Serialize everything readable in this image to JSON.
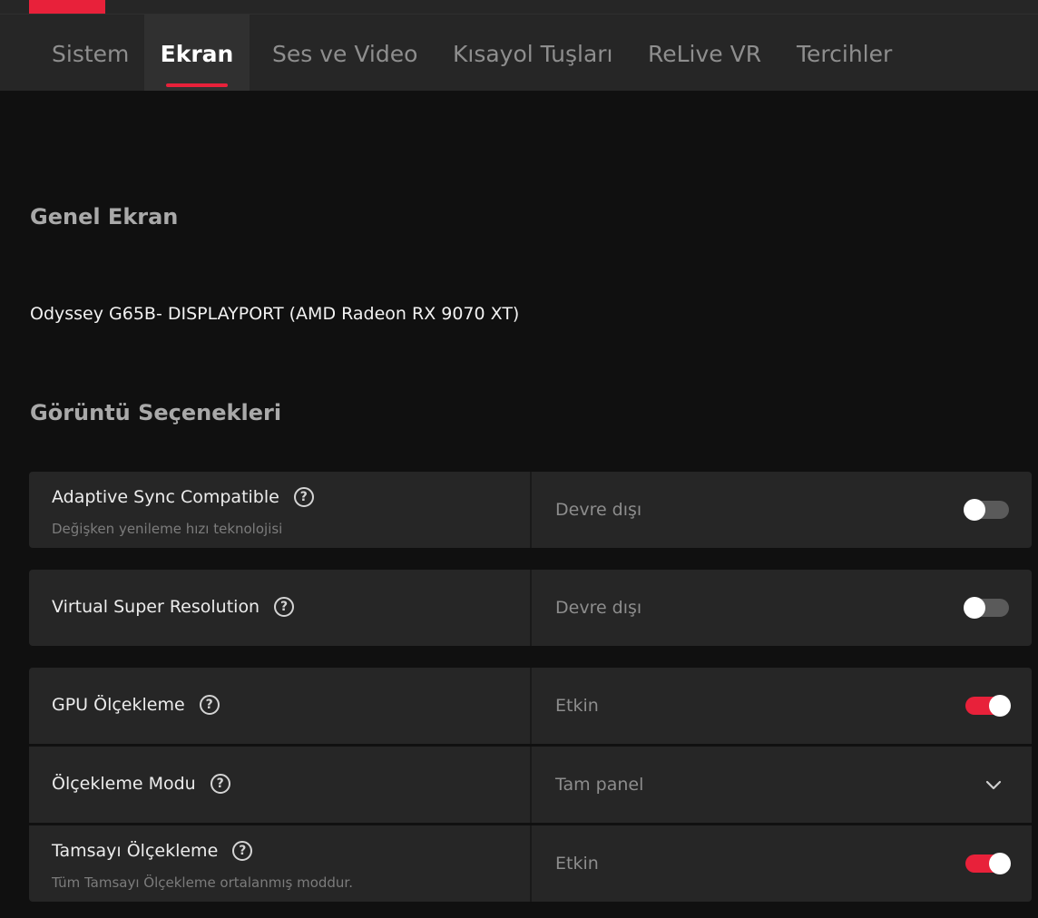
{
  "tabs": [
    {
      "label": "Sistem",
      "active": false
    },
    {
      "label": "Ekran",
      "active": true
    },
    {
      "label": "Ses ve Video",
      "active": false
    },
    {
      "label": "Kısayol Tuşları",
      "active": false
    },
    {
      "label": "ReLive VR",
      "active": false
    },
    {
      "label": "Tercihler",
      "active": false
    }
  ],
  "sections": {
    "general_title": "Genel Ekran",
    "display_name": "Odyssey G65B- DISPLAYPORT (AMD Radeon RX 9070 XT)",
    "options_title": "Görüntü Seçenekleri"
  },
  "settings": [
    {
      "label": "Adaptive Sync Compatible",
      "description": "Değişken yenileme hızı teknolojisi",
      "value": "Devre dışı",
      "control": "toggle",
      "enabled": false
    },
    {
      "label": "Virtual Super Resolution",
      "value": "Devre dışı",
      "control": "toggle",
      "enabled": false
    },
    {
      "label": "GPU Ölçekleme",
      "value": "Etkin",
      "control": "toggle",
      "enabled": true
    },
    {
      "label": "Ölçekleme Modu",
      "value": "Tam panel",
      "control": "dropdown"
    },
    {
      "label": "Tamsayı Ölçekleme",
      "description": "Tüm Tamsayı Ölçekleme ortalanmış moddur.",
      "value": "Etkin",
      "control": "toggle",
      "enabled": true
    }
  ],
  "icons": {
    "help": "?",
    "help_icon_name": "help-circle-icon",
    "dropdown_icon_name": "chevron-down-icon"
  },
  "colors": {
    "accent": "#e8213a",
    "background": "#101010",
    "panel": "#262626"
  }
}
